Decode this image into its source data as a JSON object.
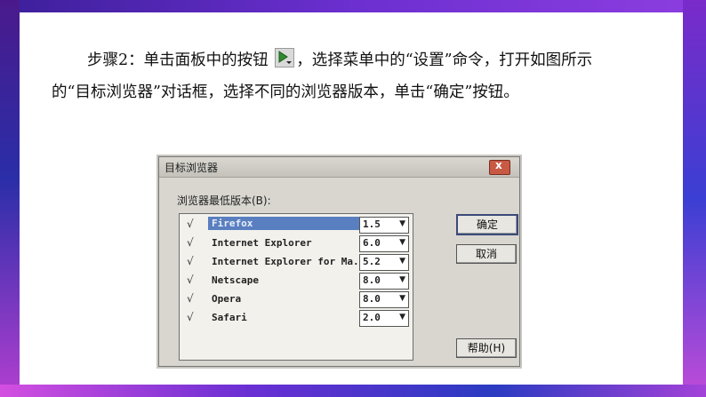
{
  "instruction": {
    "line1_before": "步骤2：单击面板中的按钮 ",
    "line1_after": "，选择菜单中的“设置”命令，打开如图所示",
    "line2": "的“目标浏览器”对话框，选择不同的浏览器版本，单击“确定”按钮。",
    "inline_icon": "play-dropdown-icon"
  },
  "dialog": {
    "title": "目标浏览器",
    "close_label": "x",
    "group_label": "浏览器最低版本(B):",
    "browsers": [
      {
        "name": "Firefox",
        "version": "1.5",
        "checked": true,
        "selected": true
      },
      {
        "name": "Internet Explorer",
        "version": "6.0",
        "checked": true
      },
      {
        "name": "Internet Explorer for Ma...",
        "version": "5.2",
        "checked": true
      },
      {
        "name": "Netscape",
        "version": "8.0",
        "checked": true
      },
      {
        "name": "Opera",
        "version": "8.0",
        "checked": true
      },
      {
        "name": "Safari",
        "version": "2.0",
        "checked": true
      }
    ],
    "check_mark": "√",
    "dropdown_arrow": "▼",
    "ok_label": "确定",
    "cancel_label": "取消",
    "help_label": "帮助(H)"
  },
  "colors": {
    "frame_purple": "#6c2fd0",
    "selection_blue": "#5a7fc0",
    "close_red": "#c85a44"
  }
}
